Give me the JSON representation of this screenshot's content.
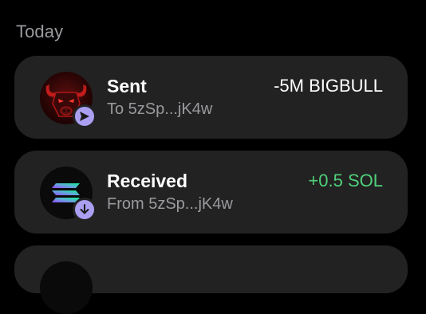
{
  "section": {
    "title": "Today"
  },
  "transactions": [
    {
      "type": "Sent",
      "counterparty": "To 5zSp...jK4w",
      "amount": "-5M BIGBULL",
      "token_icon": "bigbull-token-icon",
      "badge_icon": "send-arrow-icon",
      "amount_color": "#ffffff"
    },
    {
      "type": "Received",
      "counterparty": "From 5zSp...jK4w",
      "amount": "+0.5 SOL",
      "token_icon": "solana-token-icon",
      "badge_icon": "receive-arrow-icon",
      "amount_color": "#4fd07a"
    }
  ],
  "colors": {
    "background": "#000000",
    "card": "#222222",
    "badge": "#ab9ff2",
    "muted_text": "#9a9a9f",
    "positive": "#4fd07a"
  }
}
